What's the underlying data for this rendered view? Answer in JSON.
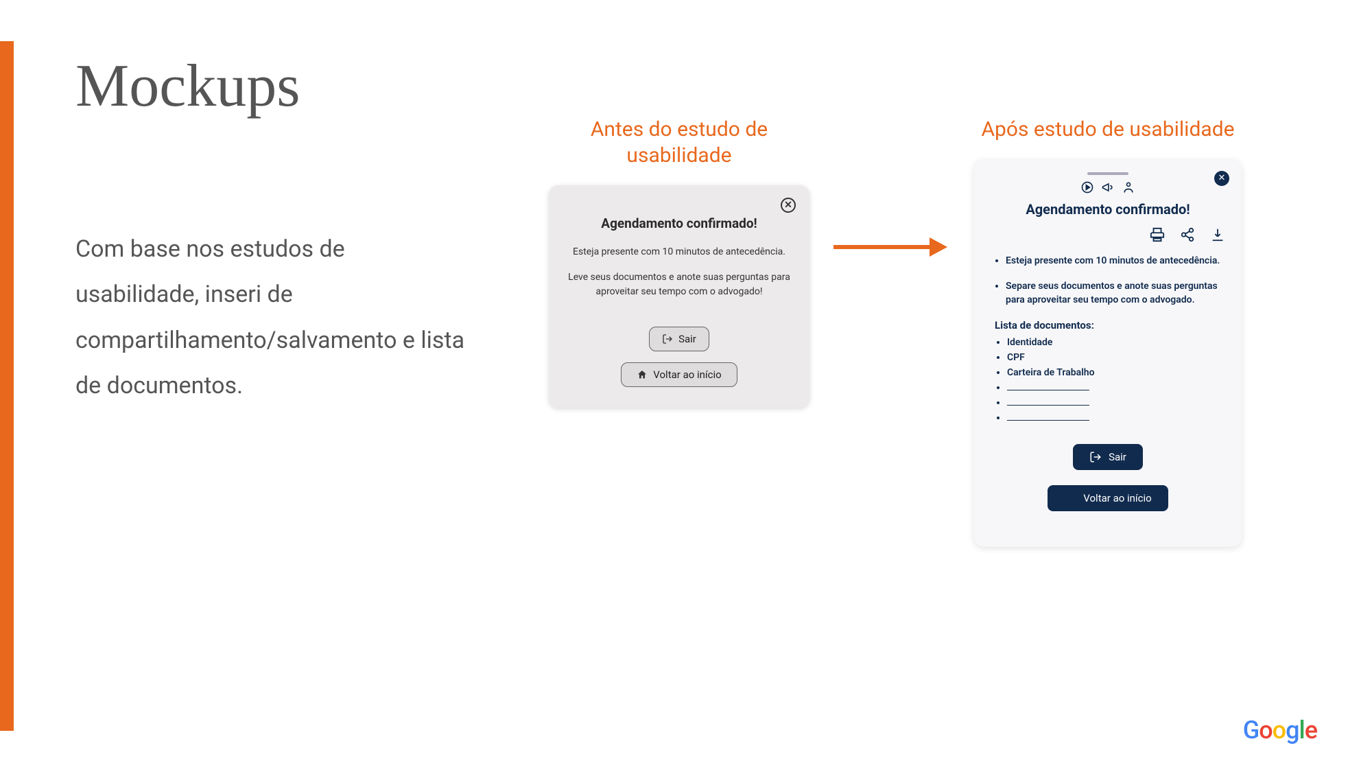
{
  "title": "Mockups",
  "body_text": "Com base nos estudos de usabilidade, inseri de compartilhamento/salvamento e lista de documentos.",
  "before": {
    "label": "Antes do estudo de usabilidade",
    "heading": "Agendamento confirmado!",
    "line1": "Esteja presente com 10 minutos de antecedência.",
    "line2": "Leve seus documentos e anote suas perguntas para aproveitar seu tempo com o advogado!",
    "btn_exit": "Sair",
    "btn_home": "Voltar ao início"
  },
  "after": {
    "label": "Após estudo de usabilidade",
    "heading": "Agendamento confirmado!",
    "bullet1": "Esteja presente com 10 minutos de antecedência.",
    "bullet2": "Separe seus documentos e anote suas perguntas para aproveitar seu tempo com o advogado.",
    "docs_title": "Lista de documentos:",
    "doc1": "Identidade",
    "doc2": "CPF",
    "doc3": "Carteira de Trabalho",
    "btn_exit": "Sair",
    "btn_home": "Voltar ao início"
  },
  "footer_logo": "Google"
}
